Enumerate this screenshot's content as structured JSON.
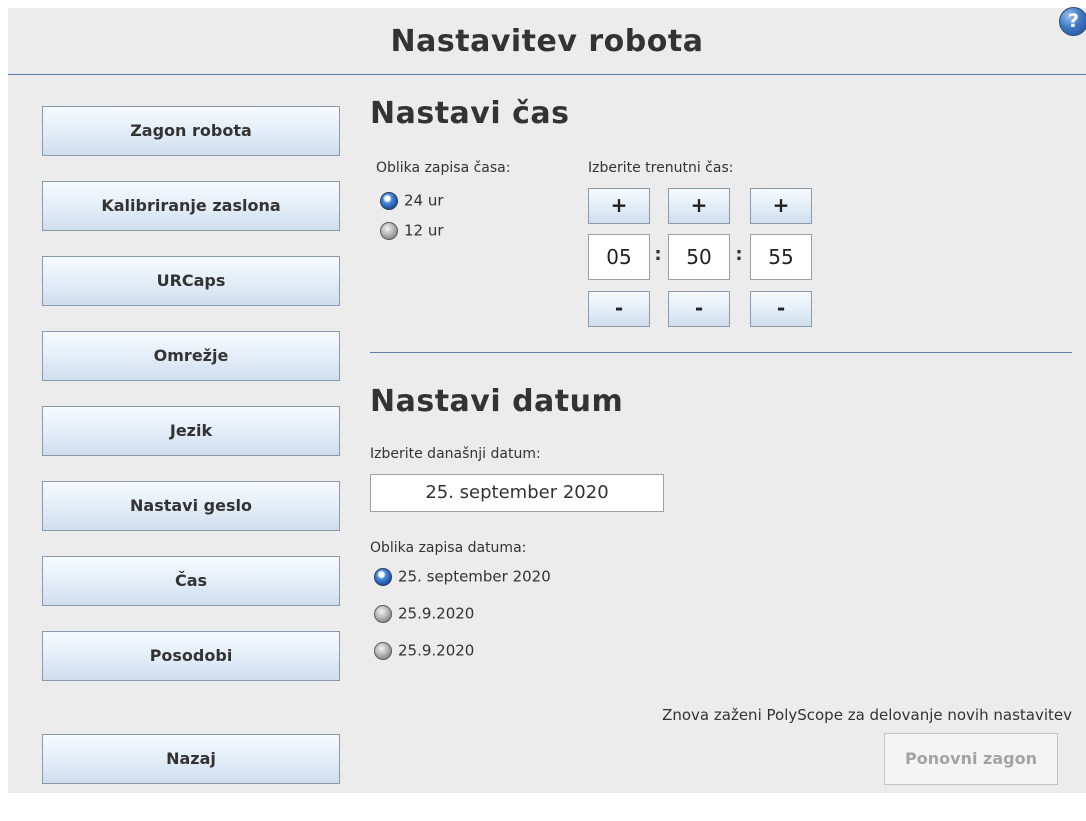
{
  "header": {
    "title": "Nastavitev robota",
    "help_icon": "question-icon"
  },
  "sidebar": {
    "items": [
      {
        "label": "Zagon robota"
      },
      {
        "label": "Kalibriranje zaslona"
      },
      {
        "label": "URCaps"
      },
      {
        "label": "Omrežje"
      },
      {
        "label": "Jezik"
      },
      {
        "label": "Nastavi geslo"
      },
      {
        "label": "Čas"
      },
      {
        "label": "Posodobi"
      }
    ],
    "back_label": "Nazaj"
  },
  "time": {
    "title": "Nastavi čas",
    "format_label": "Oblika zapisa časa:",
    "format_options": [
      {
        "label": "24 ur",
        "selected": true
      },
      {
        "label": "12 ur",
        "selected": false
      }
    ],
    "select_label": "Izberite trenutni čas:",
    "plus": "+",
    "minus": "-",
    "separator": ":",
    "hours": "05",
    "minutes": "50",
    "seconds": "55"
  },
  "date": {
    "title": "Nastavi datum",
    "select_label": "Izberite današnji datum:",
    "value": "25. september 2020",
    "format_label": "Oblika zapisa datuma:",
    "format_options": [
      {
        "label": "25. september 2020",
        "selected": true
      },
      {
        "label": "25.9.2020",
        "selected": false
      },
      {
        "label": "25.9.2020",
        "selected": false
      }
    ]
  },
  "restart": {
    "note": "Znova zaženi PolyScope za delovanje novih nastavitev",
    "button_label": "Ponovni zagon",
    "button_enabled": false
  },
  "colors": {
    "accent_line": "#5b7fa6",
    "background": "#ececec",
    "button_gradient_top": "#f7fbff",
    "button_gradient_bottom": "#cfdeee",
    "radio_selected": "#1a4a9a"
  }
}
